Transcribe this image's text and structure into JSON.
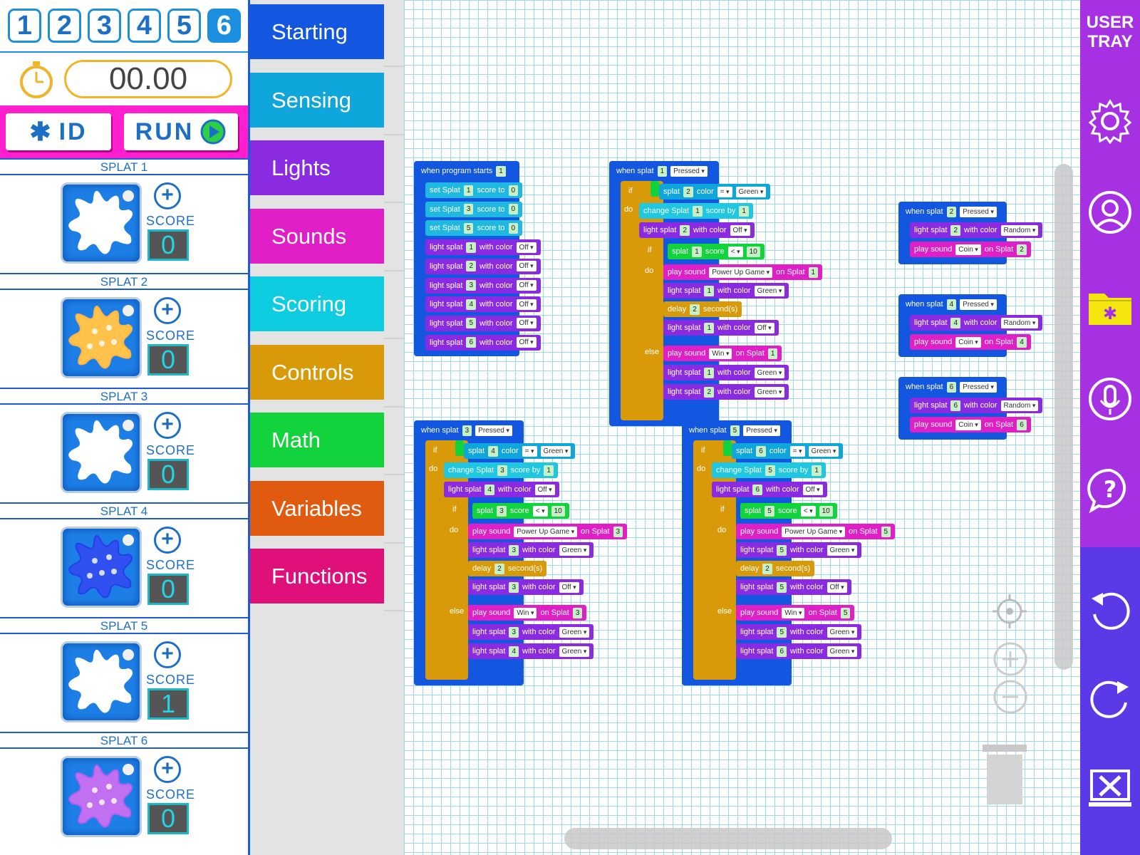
{
  "tabs": [
    "1",
    "2",
    "3",
    "4",
    "5",
    "6"
  ],
  "active_tab": "6",
  "timer": "00.00",
  "id_label": "ID",
  "run_label": "RUN",
  "splats": [
    {
      "title": "SPLAT 1",
      "score_label": "SCORE",
      "score": "0",
      "color": "#ffffff",
      "glow": "none"
    },
    {
      "title": "SPLAT 2",
      "score_label": "SCORE",
      "score": "0",
      "color": "#ffc24a",
      "glow": "orange"
    },
    {
      "title": "SPLAT 3",
      "score_label": "SCORE",
      "score": "0",
      "color": "#ffffff",
      "glow": "none"
    },
    {
      "title": "SPLAT 4",
      "score_label": "SCORE",
      "score": "0",
      "color": "#3050f0",
      "glow": "blue"
    },
    {
      "title": "SPLAT 5",
      "score_label": "SCORE",
      "score": "1",
      "color": "#ffffff",
      "glow": "none"
    },
    {
      "title": "SPLAT 6",
      "score_label": "SCORE",
      "score": "0",
      "color": "#c070f0",
      "glow": "purple"
    }
  ],
  "categories": [
    {
      "label": "Starting",
      "color": "#1357e0"
    },
    {
      "label": "Sensing",
      "color": "#0fa6dc"
    },
    {
      "label": "Lights",
      "color": "#8a2be2"
    },
    {
      "label": "Sounds",
      "color": "#e01fc6"
    },
    {
      "label": "Scoring",
      "color": "#0fcde0"
    },
    {
      "label": "Controls",
      "color": "#d99a0a"
    },
    {
      "label": "Math",
      "color": "#12d33c"
    },
    {
      "label": "Variables",
      "color": "#e05a10"
    },
    {
      "label": "Functions",
      "color": "#e0107a"
    }
  ],
  "tray": {
    "title_line1": "USER",
    "title_line2": "TRAY"
  },
  "blocks": {
    "g1": {
      "hat": [
        "when program starts",
        "1"
      ],
      "rows": [
        [
          "set Splat",
          "1",
          "score to",
          "0"
        ],
        [
          "set Splat",
          "3",
          "score to",
          "0"
        ],
        [
          "set Splat",
          "5",
          "score to",
          "0"
        ],
        [
          "light splat",
          "1",
          "with color",
          "Off"
        ],
        [
          "light splat",
          "2",
          "with color",
          "Off"
        ],
        [
          "light splat",
          "3",
          "with color",
          "Off"
        ],
        [
          "light splat",
          "4",
          "with color",
          "Off"
        ],
        [
          "light splat",
          "5",
          "with color",
          "Off"
        ],
        [
          "light splat",
          "6",
          "with color",
          "Off"
        ]
      ]
    },
    "g2": {
      "hat": [
        "when splat",
        "1",
        "Pressed"
      ],
      "if1": [
        "if",
        "splat",
        "2",
        "color",
        "=",
        "Green"
      ],
      "change": [
        "change Splat",
        "1",
        "score by",
        "1"
      ],
      "light_off": [
        "light splat",
        "2",
        "with color",
        "Off"
      ],
      "if2": [
        "if",
        "splat",
        "1",
        "score",
        "<",
        "10"
      ],
      "sound1": [
        "play sound",
        "Power Up Game",
        "on Splat",
        "1"
      ],
      "light_green": [
        "light splat",
        "1",
        "with color",
        "Green"
      ],
      "delay": [
        "delay",
        "2",
        "second(s)"
      ],
      "light_off2": [
        "light splat",
        "1",
        "with color",
        "Off"
      ],
      "sound2": [
        "play sound",
        "Win",
        "on Splat",
        "1"
      ],
      "else_l1": [
        "light splat",
        "1",
        "with color",
        "Green"
      ],
      "else_l2": [
        "light splat",
        "2",
        "with color",
        "Green"
      ],
      "do_label": "do",
      "else_label": "else"
    },
    "g3": {
      "hat": [
        "when splat",
        "3",
        "Pressed"
      ],
      "if1": [
        "if",
        "splat",
        "4",
        "color",
        "=",
        "Green"
      ],
      "change": [
        "change Splat",
        "3",
        "score by",
        "1"
      ],
      "light_off": [
        "light splat",
        "4",
        "with color",
        "Off"
      ],
      "if2": [
        "if",
        "splat",
        "3",
        "score",
        "<",
        "10"
      ],
      "sound1": [
        "play sound",
        "Power Up Game",
        "on Splat",
        "3"
      ],
      "light_green": [
        "light splat",
        "3",
        "with color",
        "Green"
      ],
      "delay": [
        "delay",
        "2",
        "second(s)"
      ],
      "light_off2": [
        "light splat",
        "3",
        "with color",
        "Off"
      ],
      "sound2": [
        "play sound",
        "Win",
        "on Splat",
        "3"
      ],
      "else_l1": [
        "light splat",
        "3",
        "with color",
        "Green"
      ],
      "else_l2": [
        "light splat",
        "4",
        "with color",
        "Green"
      ],
      "do_label": "do",
      "else_label": "else"
    },
    "g4": {
      "hat": [
        "when splat",
        "5",
        "Pressed"
      ],
      "if1": [
        "if",
        "splat",
        "6",
        "color",
        "=",
        "Green"
      ],
      "change": [
        "change Splat",
        "5",
        "score by",
        "1"
      ],
      "light_off": [
        "light splat",
        "6",
        "with color",
        "Off"
      ],
      "if2": [
        "if",
        "splat",
        "5",
        "score",
        "<",
        "10"
      ],
      "sound1": [
        "play sound",
        "Power Up Game",
        "on Splat",
        "5"
      ],
      "light_green": [
        "light splat",
        "5",
        "with color",
        "Green"
      ],
      "delay": [
        "delay",
        "2",
        "second(s)"
      ],
      "light_off2": [
        "light splat",
        "5",
        "with color",
        "Off"
      ],
      "sound2": [
        "play sound",
        "Win",
        "on Splat",
        "5"
      ],
      "else_l1": [
        "light splat",
        "5",
        "with color",
        "Green"
      ],
      "else_l2": [
        "light splat",
        "6",
        "with color",
        "Green"
      ],
      "do_label": "do",
      "else_label": "else"
    },
    "g5": {
      "hat": [
        "when splat",
        "2",
        "Pressed"
      ],
      "r1": [
        "light splat",
        "2",
        "with color",
        "Random"
      ],
      "r2": [
        "play sound",
        "Coin",
        "on Splat",
        "2"
      ]
    },
    "g6": {
      "hat": [
        "when splat",
        "4",
        "Pressed"
      ],
      "r1": [
        "light splat",
        "4",
        "with color",
        "Random"
      ],
      "r2": [
        "play sound",
        "Coin",
        "on Splat",
        "4"
      ]
    },
    "g7": {
      "hat": [
        "when splat",
        "6",
        "Pressed"
      ],
      "r1": [
        "light splat",
        "6",
        "with color",
        "Random"
      ],
      "r2": [
        "play sound",
        "Coin",
        "on Splat",
        "6"
      ]
    }
  }
}
